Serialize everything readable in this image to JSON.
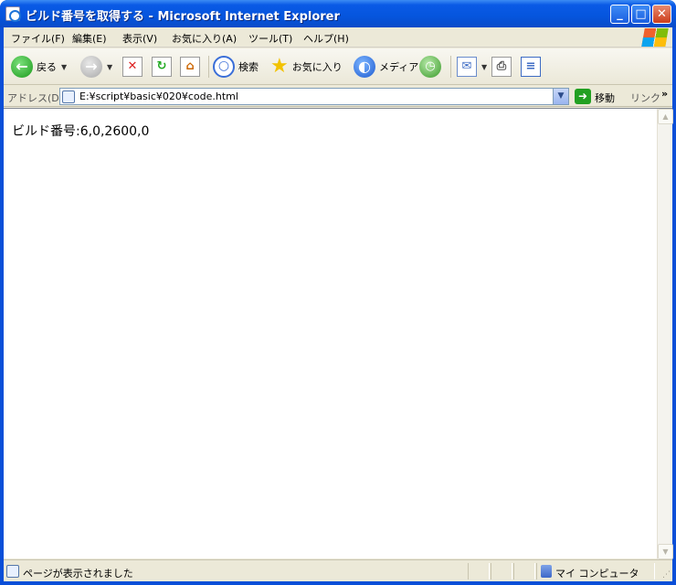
{
  "window": {
    "title": "ビルド番号を取得する - Microsoft Internet Explorer",
    "minimize_glyph": "_",
    "maximize_glyph": "□",
    "close_glyph": "✕"
  },
  "menubar": {
    "items": [
      {
        "label": "ファイル(F)"
      },
      {
        "label": "編集(E)"
      },
      {
        "label": "表示(V)"
      },
      {
        "label": "お気に入り(A)"
      },
      {
        "label": "ツール(T)"
      },
      {
        "label": "ヘルプ(H)"
      }
    ]
  },
  "toolbar": {
    "back_label": "戻る",
    "search_label": "検索",
    "favorites_label": "お気に入り",
    "media_label": "メディア",
    "icons": {
      "back": "back-arrow-icon",
      "forward": "forward-arrow-icon",
      "stop": "stop-icon",
      "refresh": "refresh-icon",
      "home": "home-icon",
      "search": "search-icon",
      "favorites": "star-icon",
      "media": "media-icon",
      "history": "history-icon",
      "mail": "mail-icon",
      "print": "print-icon",
      "edit": "edit-icon"
    }
  },
  "addressbar": {
    "label": "アドレス(D)",
    "value": "E:¥script¥basic¥020¥code.html",
    "go_label": "移動",
    "links_label": "リンク",
    "links_chevron": "»"
  },
  "content": {
    "text": "ビルド番号:6,0,2600,0"
  },
  "statusbar": {
    "text": "ページが表示されました",
    "zone": "マイ コンピュータ"
  }
}
